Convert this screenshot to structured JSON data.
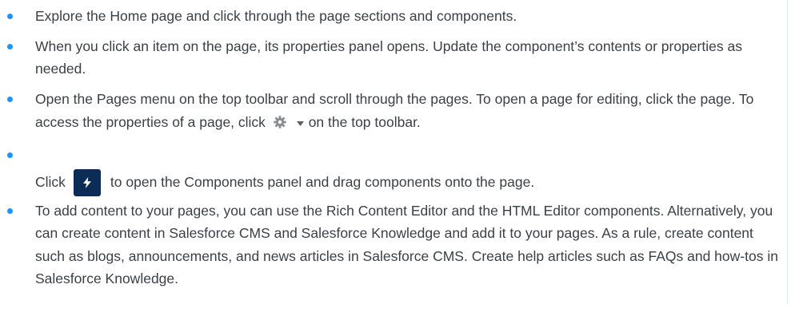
{
  "bullets": [
    {
      "text": "Explore the Home page and click through the page sections and components."
    },
    {
      "text": "When you click an item on the page, its properties panel opens. Update the component’s contents or properties as needed."
    },
    {
      "text_before": "Open the Pages menu on the top toolbar and scroll through the pages. To open a page for editing, click the page. To access the properties of a page, click",
      "text_after": "on the top toolbar.",
      "icons": [
        "gear-icon",
        "caret-down-icon"
      ]
    },
    {
      "text_before": "Click",
      "text_after": "to open the Components panel and drag components onto the page.",
      "icon": "lightning-bolt-icon",
      "button_color": "#0b2d55"
    },
    {
      "text": "To add content to your pages, you can use the Rich Content Editor and the HTML Editor components. Alternatively, you can create content in Salesforce CMS and Salesforce Knowledge and add it to your pages. As a rule, create content such as blogs, announcements, and news articles in Salesforce CMS. Create help articles such as FAQs and how-tos in Salesforce Knowledge."
    }
  ],
  "colors": {
    "bullet": "#1b96ff",
    "text": "#3c3f46",
    "rule": "#dbe8f3"
  }
}
